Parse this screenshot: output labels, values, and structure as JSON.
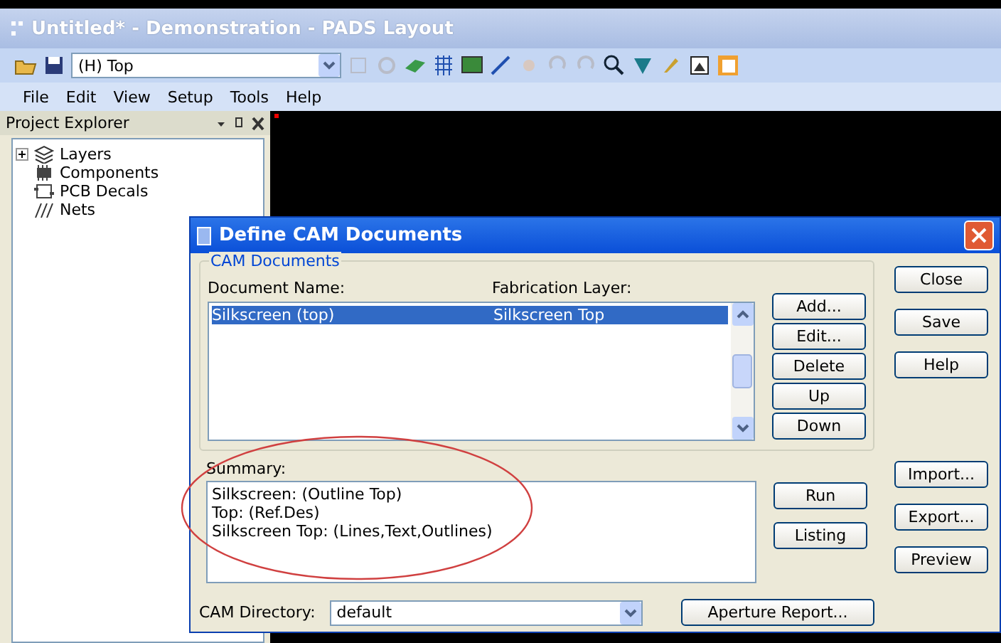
{
  "window": {
    "title": "Untitled* - Demonstration - PADS Layout"
  },
  "toolbar": {
    "layer_select": "(H) Top"
  },
  "menu": [
    "File",
    "Edit",
    "View",
    "Setup",
    "Tools",
    "Help"
  ],
  "project_explorer": {
    "title": "Project Explorer",
    "items": [
      {
        "label": "Layers",
        "kind": "layers",
        "expanded": false
      },
      {
        "label": "Components",
        "kind": "components"
      },
      {
        "label": "PCB Decals",
        "kind": "decals"
      },
      {
        "label": "Nets",
        "kind": "nets"
      }
    ]
  },
  "dialog": {
    "title": "Define CAM Documents",
    "group_label": "CAM Documents",
    "columns": [
      "Document Name:",
      "Fabrication Layer:"
    ],
    "rows": [
      {
        "cells": [
          "Silkscreen (top)",
          "Silkscreen Top"
        ],
        "selected": true
      }
    ],
    "list_buttons": [
      "Add...",
      "Edit...",
      "Delete",
      "Up",
      "Down"
    ],
    "side_buttons": [
      "Close",
      "Save",
      "Help"
    ],
    "side_buttons_lower": [
      "Import...",
      "Export...",
      "Preview"
    ],
    "summary_label": "Summary:",
    "summary_lines": [
      "Silkscreen: (Outline Top)",
      "Top: (Ref.Des)",
      "Silkscreen Top: (Lines,Text,Outlines)"
    ],
    "run_buttons": [
      "Run",
      "Listing"
    ],
    "cam_directory": {
      "label": "CAM Directory:",
      "value": "default"
    },
    "aperture_button": "Aperture Report..."
  }
}
